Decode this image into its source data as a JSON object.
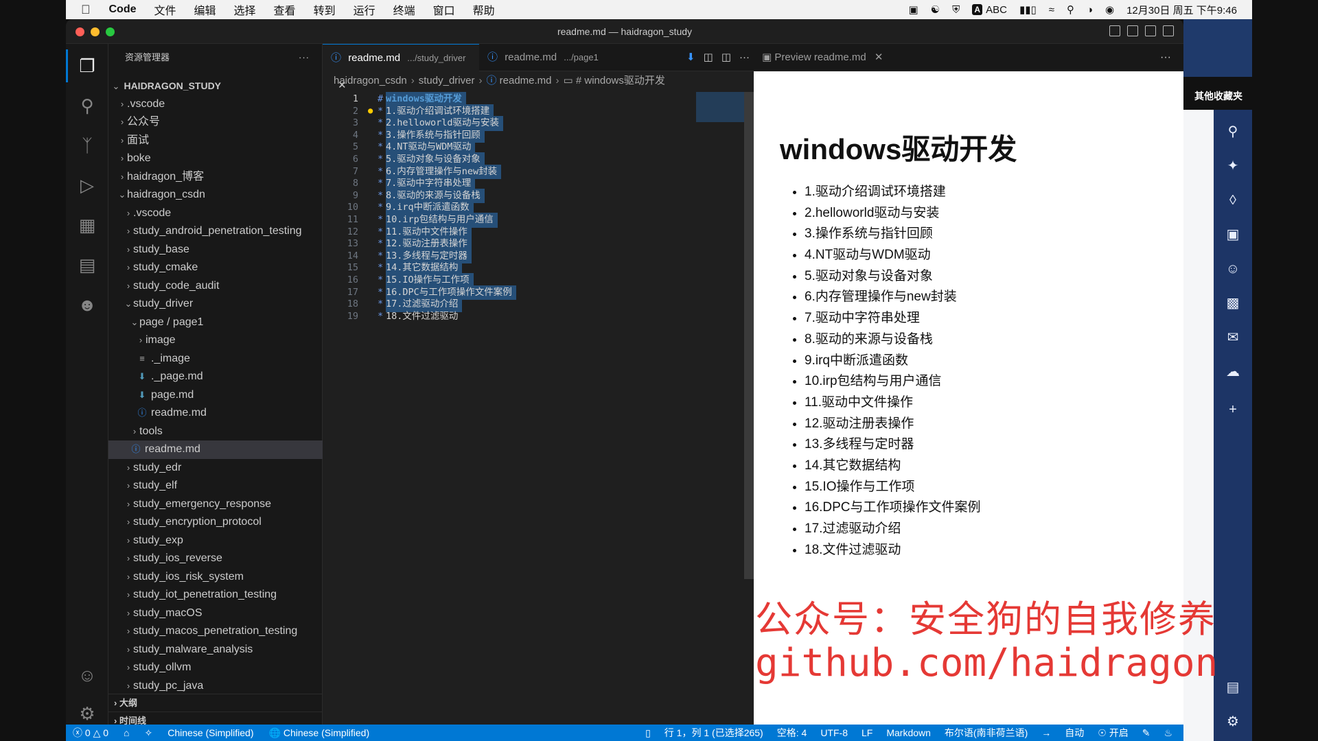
{
  "menubar": {
    "apple": "",
    "app": "Code",
    "items": [
      "文件",
      "编辑",
      "选择",
      "查看",
      "转到",
      "运行",
      "终端",
      "窗口",
      "帮助"
    ],
    "abc": "ABC",
    "datetime": "12月30日 周五 下午9:46"
  },
  "window": {
    "title": "readme.md — haidragon_study"
  },
  "sidebar": {
    "header": "资源管理器",
    "root": "HAIDRAGON_STUDY",
    "tree": [
      {
        "label": ".vscode",
        "indent": 1,
        "type": "folder",
        "open": false
      },
      {
        "label": "公众号",
        "indent": 1,
        "type": "folder",
        "open": false
      },
      {
        "label": "面试",
        "indent": 1,
        "type": "folder",
        "open": false
      },
      {
        "label": "boke",
        "indent": 1,
        "type": "folder",
        "open": false
      },
      {
        "label": "haidragon_博客",
        "indent": 1,
        "type": "folder",
        "open": false
      },
      {
        "label": "haidragon_csdn",
        "indent": 1,
        "type": "folder",
        "open": true
      },
      {
        "label": ".vscode",
        "indent": 2,
        "type": "folder",
        "open": false
      },
      {
        "label": "study_android_penetration_testing",
        "indent": 2,
        "type": "folder",
        "open": false
      },
      {
        "label": "study_base",
        "indent": 2,
        "type": "folder",
        "open": false
      },
      {
        "label": "study_cmake",
        "indent": 2,
        "type": "folder",
        "open": false
      },
      {
        "label": "study_code_audit",
        "indent": 2,
        "type": "folder",
        "open": false
      },
      {
        "label": "study_driver",
        "indent": 2,
        "type": "folder",
        "open": true
      },
      {
        "label": "page / page1",
        "indent": 3,
        "type": "folder",
        "open": true
      },
      {
        "label": "image",
        "indent": 4,
        "type": "folder",
        "open": false
      },
      {
        "label": "._image",
        "indent": 4,
        "type": "file-lines",
        "open": null
      },
      {
        "label": "._page.md",
        "indent": 4,
        "type": "file-md",
        "open": null
      },
      {
        "label": "page.md",
        "indent": 4,
        "type": "file-md",
        "open": null
      },
      {
        "label": "readme.md",
        "indent": 4,
        "type": "file-info",
        "open": null
      },
      {
        "label": "tools",
        "indent": 3,
        "type": "folder",
        "open": false
      },
      {
        "label": "readme.md",
        "indent": 3,
        "type": "file-info",
        "open": null,
        "selected": true
      },
      {
        "label": "study_edr",
        "indent": 2,
        "type": "folder",
        "open": false
      },
      {
        "label": "study_elf",
        "indent": 2,
        "type": "folder",
        "open": false
      },
      {
        "label": "study_emergency_response",
        "indent": 2,
        "type": "folder",
        "open": false
      },
      {
        "label": "study_encryption_protocol",
        "indent": 2,
        "type": "folder",
        "open": false
      },
      {
        "label": "study_exp",
        "indent": 2,
        "type": "folder",
        "open": false
      },
      {
        "label": "study_ios_reverse",
        "indent": 2,
        "type": "folder",
        "open": false
      },
      {
        "label": "study_ios_risk_system",
        "indent": 2,
        "type": "folder",
        "open": false
      },
      {
        "label": "study_iot_penetration_testing",
        "indent": 2,
        "type": "folder",
        "open": false
      },
      {
        "label": "study_macOS",
        "indent": 2,
        "type": "folder",
        "open": false
      },
      {
        "label": "study_macos_penetration_testing",
        "indent": 2,
        "type": "folder",
        "open": false
      },
      {
        "label": "study_malware_analysis",
        "indent": 2,
        "type": "folder",
        "open": false
      },
      {
        "label": "study_ollvm",
        "indent": 2,
        "type": "folder",
        "open": false
      },
      {
        "label": "study_pc_java",
        "indent": 2,
        "type": "folder",
        "open": false
      }
    ],
    "outline": "大纲",
    "timeline": "时间线"
  },
  "editor": {
    "tabs": [
      {
        "name": "readme.md",
        "desc": ".../study_driver",
        "active": true
      },
      {
        "name": "readme.md",
        "desc": ".../page1",
        "active": false
      }
    ],
    "breadcrumb": [
      "haidragon_csdn",
      "study_driver",
      "readme.md",
      "# windows驱动开发"
    ],
    "lines": [
      {
        "n": "1",
        "text": "windows驱动开发",
        "h1": true,
        "sel": true
      },
      {
        "n": "2",
        "text": "1.驱动介绍调试环境搭建",
        "sel": true
      },
      {
        "n": "3",
        "text": "2.helloworld驱动与安装",
        "sel": true
      },
      {
        "n": "4",
        "text": "3.操作系统与指针回顾",
        "sel": true
      },
      {
        "n": "5",
        "text": "4.NT驱动与WDM驱动",
        "sel": true
      },
      {
        "n": "6",
        "text": "5.驱动对象与设备对象",
        "sel": true
      },
      {
        "n": "7",
        "text": "6.内存管理操作与new封装",
        "sel": true
      },
      {
        "n": "8",
        "text": "7.驱动中字符串处理",
        "sel": true
      },
      {
        "n": "9",
        "text": "8.驱动的来源与设备栈",
        "sel": true
      },
      {
        "n": "10",
        "text": "9.irq中断派遣函数",
        "sel": true
      },
      {
        "n": "11",
        "text": "10.irp包结构与用户通信",
        "sel": true
      },
      {
        "n": "12",
        "text": "11.驱动中文件操作",
        "sel": true
      },
      {
        "n": "13",
        "text": "12.驱动注册表操作",
        "sel": true
      },
      {
        "n": "14",
        "text": "13.多线程与定时器",
        "sel": true
      },
      {
        "n": "15",
        "text": "14.其它数据结构",
        "sel": true
      },
      {
        "n": "16",
        "text": "15.IO操作与工作项",
        "sel": true
      },
      {
        "n": "17",
        "text": "16.DPC与工作项操作文件案例",
        "sel": true
      },
      {
        "n": "18",
        "text": "17.过滤驱动介绍",
        "sel": true
      },
      {
        "n": "19",
        "text": "18.文件过滤驱动",
        "sel": false
      }
    ]
  },
  "preview": {
    "tab": "Preview readme.md",
    "title": "windows驱动开发",
    "items": [
      "1.驱动介绍调试环境搭建",
      "2.helloworld驱动与安装",
      "3.操作系统与指针回顾",
      "4.NT驱动与WDM驱动",
      "5.驱动对象与设备对象",
      "6.内存管理操作与new封装",
      "7.驱动中字符串处理",
      "8.驱动的来源与设备栈",
      "9.irq中断派遣函数",
      "10.irp包结构与用户通信",
      "11.驱动中文件操作",
      "12.驱动注册表操作",
      "13.多线程与定时器",
      "14.其它数据结构",
      "15.IO操作与工作项",
      "16.DPC与工作项操作文件案例",
      "17.过滤驱动介绍",
      "18.文件过滤驱动"
    ]
  },
  "watermark": {
    "line1": "公众号：安全狗的自我修养",
    "line2": "github.com/haidragon"
  },
  "statusbar": {
    "errors": "0",
    "warnings": "0",
    "lang1": "Chinese (Simplified)",
    "lang2": "Chinese (Simplified)",
    "position": "行 1，列 1 (已选择265)",
    "spaces": "空格: 4",
    "encoding": "UTF-8",
    "eol": "LF",
    "mode": "Markdown",
    "keyboard": "布尔语(南非荷兰语)",
    "auto": "自动",
    "on": "开启"
  },
  "browser": {
    "favorites": "其他收藏夹"
  }
}
